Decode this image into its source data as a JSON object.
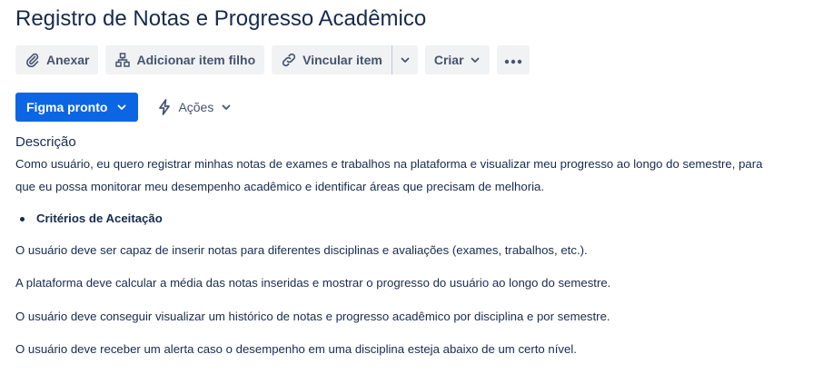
{
  "issue": {
    "title": "Registro de Notas e Progresso Acadêmico"
  },
  "toolbar": {
    "attach_label": "Anexar",
    "attach_icon": "paperclip-icon",
    "add_child_label": "Adicionar item filho",
    "add_child_icon": "hierarchy-icon",
    "link_label": "Vincular item",
    "link_icon": "link-icon",
    "create_label": "Criar",
    "more_icon": "more-icon"
  },
  "status": {
    "label": "Figma pronto",
    "color": "#0C66E4",
    "actions_label": "Ações",
    "actions_icon": "lightning-icon"
  },
  "description": {
    "heading": "Descrição",
    "intro_line1": "Como usuário, eu quero registrar minhas notas de exames e trabalhos na plataforma e visualizar meu progresso ao longo do semestre, para",
    "intro_line2": "que eu possa monitorar meu desempenho acadêmico e identificar áreas que precisam de melhoria.",
    "bullet": "Critérios de Aceitação",
    "criteria": [
      "O usuário deve ser capaz de inserir notas para diferentes disciplinas e avaliações (exames, trabalhos, etc.).",
      "A plataforma deve calcular a média das notas inseridas e mostrar o progresso do usuário ao longo do semestre.",
      "O usuário deve conseguir visualizar um histórico de notas e progresso acadêmico por disciplina e por semestre.",
      "O usuário deve receber um alerta caso o desempenho em uma disciplina esteja abaixo de um certo nível."
    ]
  }
}
